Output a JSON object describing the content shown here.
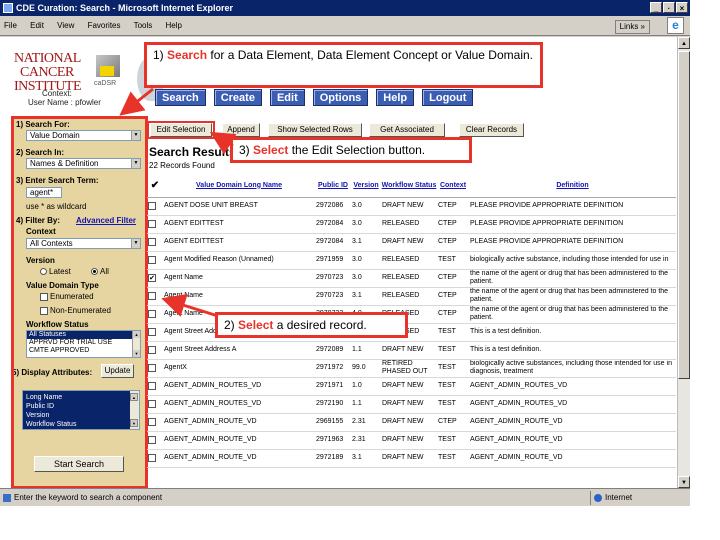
{
  "window": {
    "title": "CDE Curation: Search - Microsoft Internet Explorer",
    "controls": [
      "_",
      "·",
      "×"
    ]
  },
  "menu": {
    "items": [
      "File",
      "Edit",
      "View",
      "Favorites",
      "Tools",
      "Help"
    ],
    "links": "Links »"
  },
  "header": {
    "logo_lines": [
      "NATIONAL",
      "CANCER",
      "INSTITUTE"
    ],
    "cadsr_label": "caDSR",
    "context_label": "Context:",
    "user_label": "User Name : pfowler"
  },
  "nav": [
    "Search",
    "Create",
    "Edit",
    "Options",
    "Help",
    "Logout"
  ],
  "left_panel": {
    "search_for_label": "1) Search For:",
    "search_for_value": "Value Domain",
    "search_in_label": "2) Search In:",
    "search_in_value": "Names & Definition",
    "term_label": "3) Enter Search Term:",
    "term_value": "agent*",
    "wildcard_hint": "use * as wildcard",
    "filter_label": "4) Filter By:",
    "advanced_filter": "Advanced Filter",
    "context_label": "Context",
    "context_value": "All Contexts",
    "version_label": "Version",
    "version_latest": "Latest",
    "version_all": "All",
    "vd_type_label": "Value Domain Type",
    "vd_enumerated": "Enumerated",
    "vd_non_enumerated": "Non-Enumerated",
    "workflow_label": "Workflow Status",
    "workflow_options": [
      "All Statuses",
      "APPRVD FOR TRIAL USE",
      "CMTE APPROVED"
    ],
    "display_label": "5) Display Attributes:",
    "update_button": "Update",
    "display_options": [
      "Long Name",
      "Public ID",
      "Version",
      "Workflow Status"
    ],
    "start_search": "Start Search"
  },
  "actions": [
    "Edit Selection",
    "Append",
    "Show Selected Rows",
    "Get Associated",
    "Clear Records"
  ],
  "results": {
    "title": "Search Results",
    "count": "22 Records Found",
    "check_header": "✔",
    "columns": [
      "Value Domain Long Name",
      "Public ID",
      "Version",
      "Workflow Status",
      "Context",
      "Definition"
    ],
    "rows": [
      {
        "checked": false,
        "name": "AGENT DOSE UNIT BREAST",
        "id": "2972086",
        "ver": "3.0",
        "status": "DRAFT NEW",
        "ctx": "CTEP",
        "def": "PLEASE PROVIDE APPROPRIATE DEFINITION"
      },
      {
        "checked": false,
        "name": "AGENT EDITTEST",
        "id": "2972084",
        "ver": "3.0",
        "status": "RELEASED",
        "ctx": "CTEP",
        "def": "PLEASE PROVIDE APPROPRIATE DEFINITION"
      },
      {
        "checked": false,
        "name": "AGENT EDITTEST",
        "id": "2972084",
        "ver": "3.1",
        "status": "DRAFT NEW",
        "ctx": "CTEP",
        "def": "PLEASE PROVIDE APPROPRIATE DEFINITION"
      },
      {
        "checked": false,
        "name": "Agent Modified Reason (Unnamed)",
        "id": "2971959",
        "ver": "3.0",
        "status": "RELEASED",
        "ctx": "TEST",
        "def": "biologically active substance, including those intended for use in"
      },
      {
        "checked": true,
        "name": "Agent Name",
        "id": "2970723",
        "ver": "3.0",
        "status": "RELEASED",
        "ctx": "CTEP",
        "def": "the name of the agent or drug that has been administered to the patient."
      },
      {
        "checked": false,
        "name": "Agent Name",
        "id": "2970723",
        "ver": "3.1",
        "status": "RELEASED",
        "ctx": "CTEP",
        "def": "the name of the agent or drug that has been administered to the patient."
      },
      {
        "checked": false,
        "name": "Agent Name",
        "id": "2970723",
        "ver": "4.0",
        "status": "RELEASED",
        "ctx": "CTEP",
        "def": "the name of the agent or drug that has been administered to the patient."
      },
      {
        "checked": false,
        "name": "Agent Street Address A",
        "id": "2972089",
        "ver": "1.0",
        "status": "RELEASED",
        "ctx": "TEST",
        "def": "This is a test definition."
      },
      {
        "checked": false,
        "name": "Agent Street Address A",
        "id": "2972089",
        "ver": "1.1",
        "status": "DRAFT NEW",
        "ctx": "TEST",
        "def": "This is a test definition."
      },
      {
        "checked": false,
        "name": "AgentX",
        "id": "2971972",
        "ver": "99.0",
        "status": "RETIRED PHASED OUT",
        "ctx": "TEST",
        "def": "biologically active substances, including those intended for use in diagnosis, treatment"
      },
      {
        "checked": false,
        "name": "AGENT_ADMIN_ROUTES_VD",
        "id": "2971971",
        "ver": "1.0",
        "status": "DRAFT NEW",
        "ctx": "TEST",
        "def": "AGENT_ADMIN_ROUTES_VD"
      },
      {
        "checked": false,
        "name": "AGENT_ADMIN_ROUTES_VD",
        "id": "2972190",
        "ver": "1.1",
        "status": "DRAFT NEW",
        "ctx": "TEST",
        "def": "AGENT_ADMIN_ROUTES_VD"
      },
      {
        "checked": false,
        "name": "AGENT_ADMIN_ROUTE_VD",
        "id": "2969155",
        "ver": "2.31",
        "status": "DRAFT NEW",
        "ctx": "CTEP",
        "def": "AGENT_ADMIN_ROUTE_VD"
      },
      {
        "checked": false,
        "name": "AGENT_ADMIN_ROUTE_VD",
        "id": "2971963",
        "ver": "2.31",
        "status": "DRAFT NEW",
        "ctx": "TEST",
        "def": "AGENT_ADMIN_ROUTE_VD"
      },
      {
        "checked": false,
        "name": "AGENT_ADMIN_ROUTE_VD",
        "id": "2972189",
        "ver": "3.1",
        "status": "DRAFT NEW",
        "ctx": "TEST",
        "def": "AGENT_ADMIN_ROUTE_VD"
      }
    ]
  },
  "callouts": {
    "c1_kw": "Search",
    "c1_prefix": "1) ",
    "c1_rest": " for a Data Element, Data Element Concept or Value Domain.",
    "c2_prefix": "2) ",
    "c2_kw": "Select",
    "c2_rest": " a desired record.",
    "c3_prefix": "3) ",
    "c3_kw": "Select",
    "c3_rest": " the Edit Selection button."
  },
  "status": {
    "text": "Enter the keyword to search a component",
    "zone": "Internet"
  },
  "colors": {
    "accent_red": "#e8332a",
    "nav_blue": "#3b5eb3",
    "panel_tan": "#e6d5a0"
  }
}
